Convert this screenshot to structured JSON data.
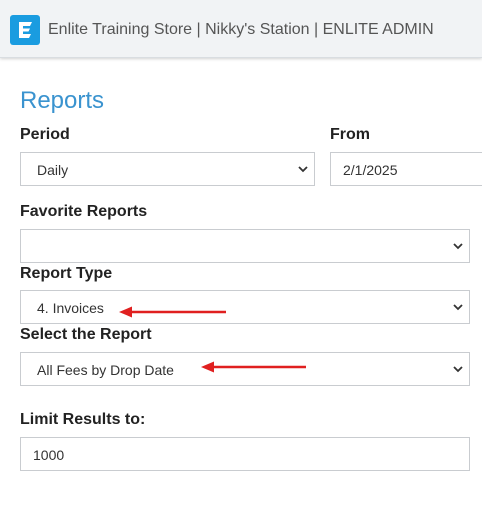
{
  "header": {
    "app_title": "Enlite Training Store | Nikky's Station | ENLITE ADMIN",
    "logo_icon": "enlite-logo-icon",
    "brand_color": "#1a9ce0"
  },
  "page": {
    "title": "Reports",
    "title_color": "#3a93cf"
  },
  "form": {
    "period": {
      "label": "Period",
      "value": "Daily"
    },
    "from": {
      "label": "From",
      "value": "2/1/2025"
    },
    "favorite_reports": {
      "label": "Favorite Reports",
      "value": ""
    },
    "report_type": {
      "label": "Report Type",
      "value": "4. Invoices"
    },
    "select_report": {
      "label": "Select the Report",
      "value": "All Fees by Drop Date"
    },
    "limit_results": {
      "label": "Limit Results to:",
      "value": "1000"
    }
  },
  "annotations": {
    "arrow_color": "#e02020",
    "icons": [
      "chevron-down-icon",
      "red-arrow-left-icon"
    ]
  }
}
